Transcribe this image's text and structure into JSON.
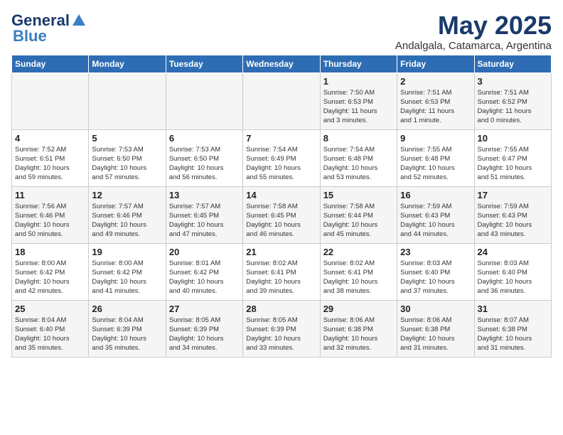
{
  "header": {
    "logo_line1": "General",
    "logo_line2": "Blue",
    "title": "May 2025",
    "subtitle": "Andalgala, Catamarca, Argentina"
  },
  "calendar": {
    "days_of_week": [
      "Sunday",
      "Monday",
      "Tuesday",
      "Wednesday",
      "Thursday",
      "Friday",
      "Saturday"
    ],
    "weeks": [
      [
        {
          "day": "",
          "info": ""
        },
        {
          "day": "",
          "info": ""
        },
        {
          "day": "",
          "info": ""
        },
        {
          "day": "",
          "info": ""
        },
        {
          "day": "1",
          "info": "Sunrise: 7:50 AM\nSunset: 6:53 PM\nDaylight: 11 hours\nand 3 minutes."
        },
        {
          "day": "2",
          "info": "Sunrise: 7:51 AM\nSunset: 6:53 PM\nDaylight: 11 hours\nand 1 minute."
        },
        {
          "day": "3",
          "info": "Sunrise: 7:51 AM\nSunset: 6:52 PM\nDaylight: 11 hours\nand 0 minutes."
        }
      ],
      [
        {
          "day": "4",
          "info": "Sunrise: 7:52 AM\nSunset: 6:51 PM\nDaylight: 10 hours\nand 59 minutes."
        },
        {
          "day": "5",
          "info": "Sunrise: 7:53 AM\nSunset: 6:50 PM\nDaylight: 10 hours\nand 57 minutes."
        },
        {
          "day": "6",
          "info": "Sunrise: 7:53 AM\nSunset: 6:50 PM\nDaylight: 10 hours\nand 56 minutes."
        },
        {
          "day": "7",
          "info": "Sunrise: 7:54 AM\nSunset: 6:49 PM\nDaylight: 10 hours\nand 55 minutes."
        },
        {
          "day": "8",
          "info": "Sunrise: 7:54 AM\nSunset: 6:48 PM\nDaylight: 10 hours\nand 53 minutes."
        },
        {
          "day": "9",
          "info": "Sunrise: 7:55 AM\nSunset: 6:48 PM\nDaylight: 10 hours\nand 52 minutes."
        },
        {
          "day": "10",
          "info": "Sunrise: 7:55 AM\nSunset: 6:47 PM\nDaylight: 10 hours\nand 51 minutes."
        }
      ],
      [
        {
          "day": "11",
          "info": "Sunrise: 7:56 AM\nSunset: 6:46 PM\nDaylight: 10 hours\nand 50 minutes."
        },
        {
          "day": "12",
          "info": "Sunrise: 7:57 AM\nSunset: 6:46 PM\nDaylight: 10 hours\nand 49 minutes."
        },
        {
          "day": "13",
          "info": "Sunrise: 7:57 AM\nSunset: 6:45 PM\nDaylight: 10 hours\nand 47 minutes."
        },
        {
          "day": "14",
          "info": "Sunrise: 7:58 AM\nSunset: 6:45 PM\nDaylight: 10 hours\nand 46 minutes."
        },
        {
          "day": "15",
          "info": "Sunrise: 7:58 AM\nSunset: 6:44 PM\nDaylight: 10 hours\nand 45 minutes."
        },
        {
          "day": "16",
          "info": "Sunrise: 7:59 AM\nSunset: 6:43 PM\nDaylight: 10 hours\nand 44 minutes."
        },
        {
          "day": "17",
          "info": "Sunrise: 7:59 AM\nSunset: 6:43 PM\nDaylight: 10 hours\nand 43 minutes."
        }
      ],
      [
        {
          "day": "18",
          "info": "Sunrise: 8:00 AM\nSunset: 6:42 PM\nDaylight: 10 hours\nand 42 minutes."
        },
        {
          "day": "19",
          "info": "Sunrise: 8:00 AM\nSunset: 6:42 PM\nDaylight: 10 hours\nand 41 minutes."
        },
        {
          "day": "20",
          "info": "Sunrise: 8:01 AM\nSunset: 6:42 PM\nDaylight: 10 hours\nand 40 minutes."
        },
        {
          "day": "21",
          "info": "Sunrise: 8:02 AM\nSunset: 6:41 PM\nDaylight: 10 hours\nand 39 minutes."
        },
        {
          "day": "22",
          "info": "Sunrise: 8:02 AM\nSunset: 6:41 PM\nDaylight: 10 hours\nand 38 minutes."
        },
        {
          "day": "23",
          "info": "Sunrise: 8:03 AM\nSunset: 6:40 PM\nDaylight: 10 hours\nand 37 minutes."
        },
        {
          "day": "24",
          "info": "Sunrise: 8:03 AM\nSunset: 6:40 PM\nDaylight: 10 hours\nand 36 minutes."
        }
      ],
      [
        {
          "day": "25",
          "info": "Sunrise: 8:04 AM\nSunset: 6:40 PM\nDaylight: 10 hours\nand 35 minutes."
        },
        {
          "day": "26",
          "info": "Sunrise: 8:04 AM\nSunset: 6:39 PM\nDaylight: 10 hours\nand 35 minutes."
        },
        {
          "day": "27",
          "info": "Sunrise: 8:05 AM\nSunset: 6:39 PM\nDaylight: 10 hours\nand 34 minutes."
        },
        {
          "day": "28",
          "info": "Sunrise: 8:05 AM\nSunset: 6:39 PM\nDaylight: 10 hours\nand 33 minutes."
        },
        {
          "day": "29",
          "info": "Sunrise: 8:06 AM\nSunset: 6:38 PM\nDaylight: 10 hours\nand 32 minutes."
        },
        {
          "day": "30",
          "info": "Sunrise: 8:06 AM\nSunset: 6:38 PM\nDaylight: 10 hours\nand 31 minutes."
        },
        {
          "day": "31",
          "info": "Sunrise: 8:07 AM\nSunset: 6:38 PM\nDaylight: 10 hours\nand 31 minutes."
        }
      ]
    ]
  }
}
